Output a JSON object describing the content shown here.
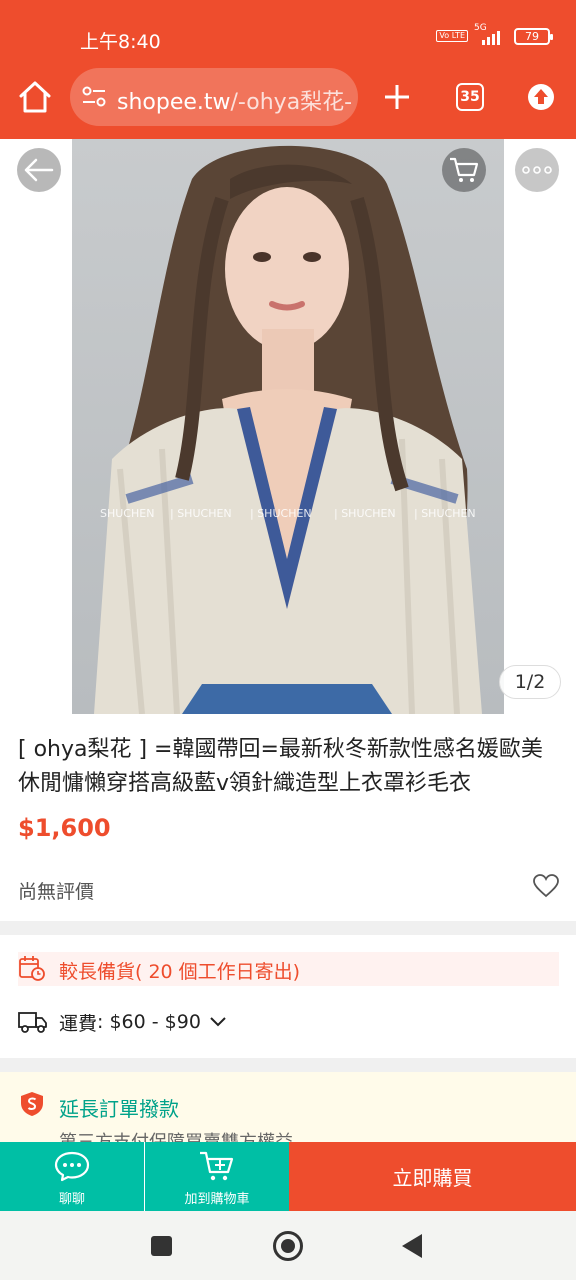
{
  "status_bar": {
    "time": "上午8:40",
    "volte": "Vo LTE",
    "network": "5G",
    "battery": "79"
  },
  "browser": {
    "url_domain": "shopee.tw",
    "url_path": "/-ohya梨花-",
    "tab_count": "35",
    "icons": [
      "home-icon",
      "site-settings-icon",
      "plus-icon",
      "tabs-icon",
      "upload-icon"
    ]
  },
  "gallery": {
    "watermarks": [
      "SHUCHEN",
      "| SHUCHEN",
      "| SHUCHEN",
      "| SHUCHEN",
      "| SHUCHEN"
    ],
    "counter": "1/2",
    "icons": [
      "back-arrow-icon",
      "cart-icon",
      "more-icon"
    ]
  },
  "product": {
    "title": "[ ohya梨花 ] =韓國帶回=最新秋冬新款性感名媛歐美休閒慵懶穿搭高級藍v領針織造型上衣罩衫毛衣",
    "price": "$1,600",
    "rating": "尚無評價"
  },
  "shipping": {
    "preorder": "較長備貨( 20 個工作日寄出)",
    "label": "運費",
    "range": ": $60 - $90"
  },
  "guarantee": {
    "title": "延長訂單撥款",
    "subtitle": "第三方支付保障買賣雙方權益"
  },
  "actions": {
    "chat": "聊聊",
    "add_to_cart": "加到購物車",
    "buy_now": "立即購買"
  },
  "colors": {
    "brand": "#ee4d2d",
    "action_teal": "#00bfa5",
    "guarantee_green": "#00a28a"
  }
}
